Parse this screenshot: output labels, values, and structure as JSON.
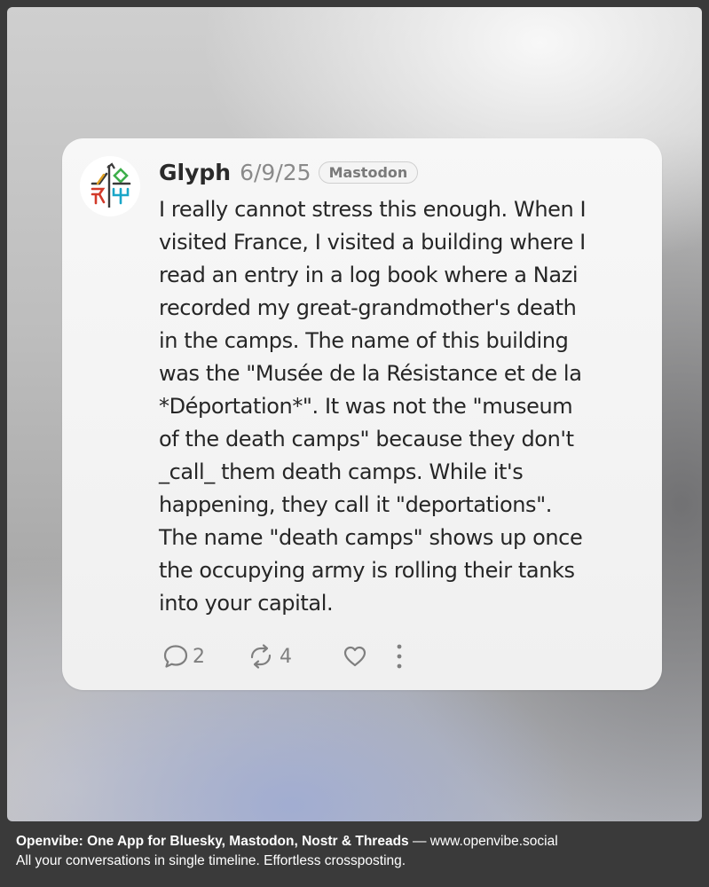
{
  "post": {
    "author": "Glyph",
    "date": "6/9/25",
    "platform": "Mastodon",
    "avatar_icon": "glyph-logo-icon",
    "lines": [
      "I really cannot stress this enough. When I",
      "visited France, I visited a building where I",
      "read an entry in a log book where a Nazi",
      "recorded my great-grandmother's death",
      "in the camps. The name of this building",
      "was the \"Musée de la Résistance et de la",
      "*Déportation*\". It was not the \"museum",
      "of the death camps\" because they don't",
      "_call_ them death camps. While it's",
      "happening, they call it \"deportations\".",
      "The name \"death camps\" shows up once",
      "the occupying army is rolling their tanks",
      "into your capital."
    ],
    "actions": {
      "replies": "2",
      "boosts": "4",
      "reply_icon": "reply-bubble-icon",
      "boost_icon": "boost-icon",
      "like_icon": "heart-icon",
      "more_icon": "more-vertical-icon"
    }
  },
  "footer": {
    "brand": "Openvibe: One App for Bluesky, Mastodon, Nostr & Threads",
    "separator": " — ",
    "url": "www.openvibe.social",
    "tagline": "All your conversations in single timeline. Effortless crossposting."
  },
  "colors": {
    "card": "#f5f5f5",
    "text": "#262626",
    "muted": "#8a8a8a",
    "footer_bg": "#3a3a3a"
  }
}
